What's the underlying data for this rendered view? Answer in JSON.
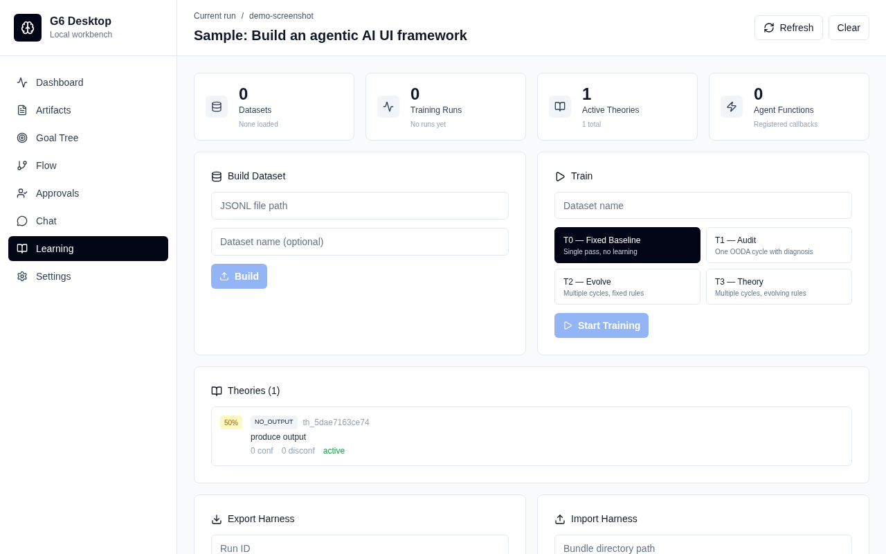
{
  "app": {
    "name": "G6 Desktop",
    "subtitle": "Local workbench"
  },
  "nav": [
    {
      "label": "Dashboard",
      "selected": false
    },
    {
      "label": "Artifacts",
      "selected": false
    },
    {
      "label": "Goal Tree",
      "selected": false
    },
    {
      "label": "Flow",
      "selected": false
    },
    {
      "label": "Approvals",
      "selected": false
    },
    {
      "label": "Chat",
      "selected": false
    },
    {
      "label": "Learning",
      "selected": true
    },
    {
      "label": "Settings",
      "selected": false
    }
  ],
  "header": {
    "breadcrumb": [
      "Current run",
      "/",
      "demo-screenshot"
    ],
    "title": "Sample: Build an agentic AI UI framework",
    "buttons": [
      {
        "label": "Refresh"
      },
      {
        "label": "Clear"
      }
    ]
  },
  "stats": [
    {
      "value": "0",
      "label": "Datasets",
      "note": "None loaded"
    },
    {
      "value": "0",
      "label": "Training Runs",
      "note": "No runs yet"
    },
    {
      "value": "1",
      "label": "Active Theories",
      "note": "1 total"
    },
    {
      "value": "0",
      "label": "Agent Functions",
      "note": "Registered callbacks"
    }
  ],
  "build_dataset": {
    "title": "Build Dataset",
    "fields": [
      {
        "placeholder": "JSONL file path"
      },
      {
        "placeholder": "Dataset name (optional)"
      }
    ],
    "button": {
      "label": "Build",
      "disabled": true
    }
  },
  "train": {
    "title": "Train",
    "field": {
      "placeholder": "Dataset name"
    },
    "tiers": [
      {
        "label": "T0 — Fixed Baseline",
        "note": "Single pass, no learning",
        "selected": true
      },
      {
        "label": "T1 — Audit",
        "note": "One OODA cycle with diagnosis",
        "selected": false
      },
      {
        "label": "T2 — Evolve",
        "note": "Multiple cycles, fixed rules",
        "selected": false
      },
      {
        "label": "T3 — Theory",
        "note": "Multiple cycles, evolving rules",
        "selected": false
      }
    ],
    "button": {
      "label": "Start Training",
      "disabled": true
    }
  },
  "theories": {
    "title": "Theories (1)",
    "items": [
      {
        "confidence": "50%",
        "tag": "NO_OUTPUT",
        "id": "th_5dae7163ce74",
        "text": "produce output",
        "conf": "0 conf",
        "disconf": "0 disconf",
        "status": "active"
      }
    ]
  },
  "export": {
    "title": "Export Harness",
    "field": {
      "placeholder": "Run ID"
    }
  },
  "import": {
    "title": "Import Harness",
    "field": {
      "placeholder": "Bundle directory path"
    }
  }
}
